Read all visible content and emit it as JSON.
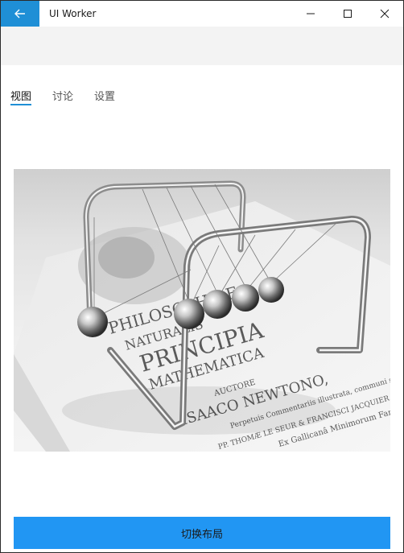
{
  "window": {
    "title": "UI Worker"
  },
  "tabs": [
    {
      "label": "视图",
      "active": true
    },
    {
      "label": "讨论",
      "active": false
    },
    {
      "label": "设置",
      "active": false
    }
  ],
  "hero": {
    "book_text_lines": [
      "PHILOSOPHIAE",
      "NATURALIS",
      "PRINCIPIA",
      "MATHEMATICA",
      "AUCTORE",
      "ISAACO NEWTONO,",
      "Perpetuis Commentariis illustrata, communi studio",
      "PP. THOMÆ LE SEUR & FRANCISCI JACQUIER",
      "Ex Gallicanâ Minimorum Familiâ"
    ]
  },
  "actions": {
    "switch_layout_label": "切换布局"
  },
  "colors": {
    "accent": "#1f8fd6",
    "button": "#2196f3",
    "band": "#f3f3f3"
  }
}
